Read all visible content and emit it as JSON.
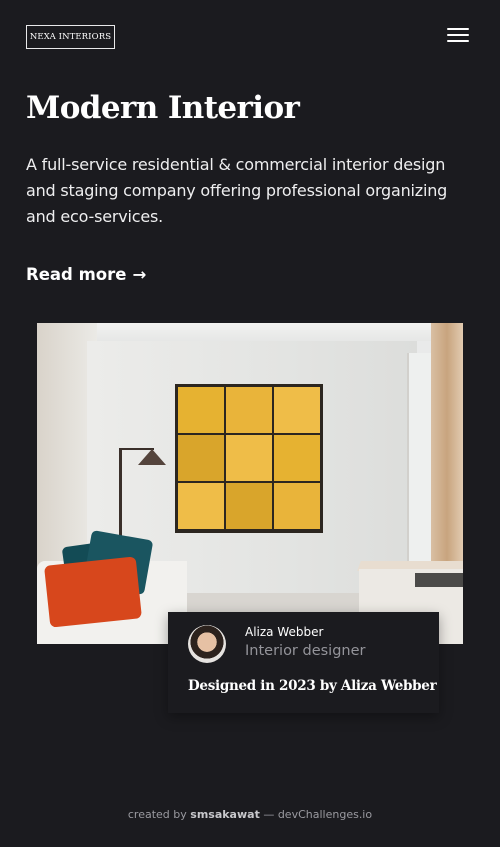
{
  "header": {
    "logo": "NEXA INTERIORS",
    "menu_icon": "hamburger-menu-icon"
  },
  "hero": {
    "title": "Modern Interior",
    "description": "A full-service residential & commercial interior design and staging company offering professional organizing and eco-services.",
    "read_more": "Read more",
    "read_more_arrow": "→"
  },
  "image": {
    "alt": "Modern living room with yellow wall art, floor lamp and sofa with teal and orange pillows"
  },
  "designer": {
    "name": "Aliza Webber",
    "role": "Interior designer",
    "credit": "Designed in 2023 by Aliza Webber"
  },
  "footer": {
    "prefix": "created by",
    "author": "smsakawat",
    "separator": "—",
    "site": "devChallenges.io"
  },
  "colors": {
    "background": "#1b1b1f",
    "text": "#ffffff",
    "muted": "#94949a"
  }
}
